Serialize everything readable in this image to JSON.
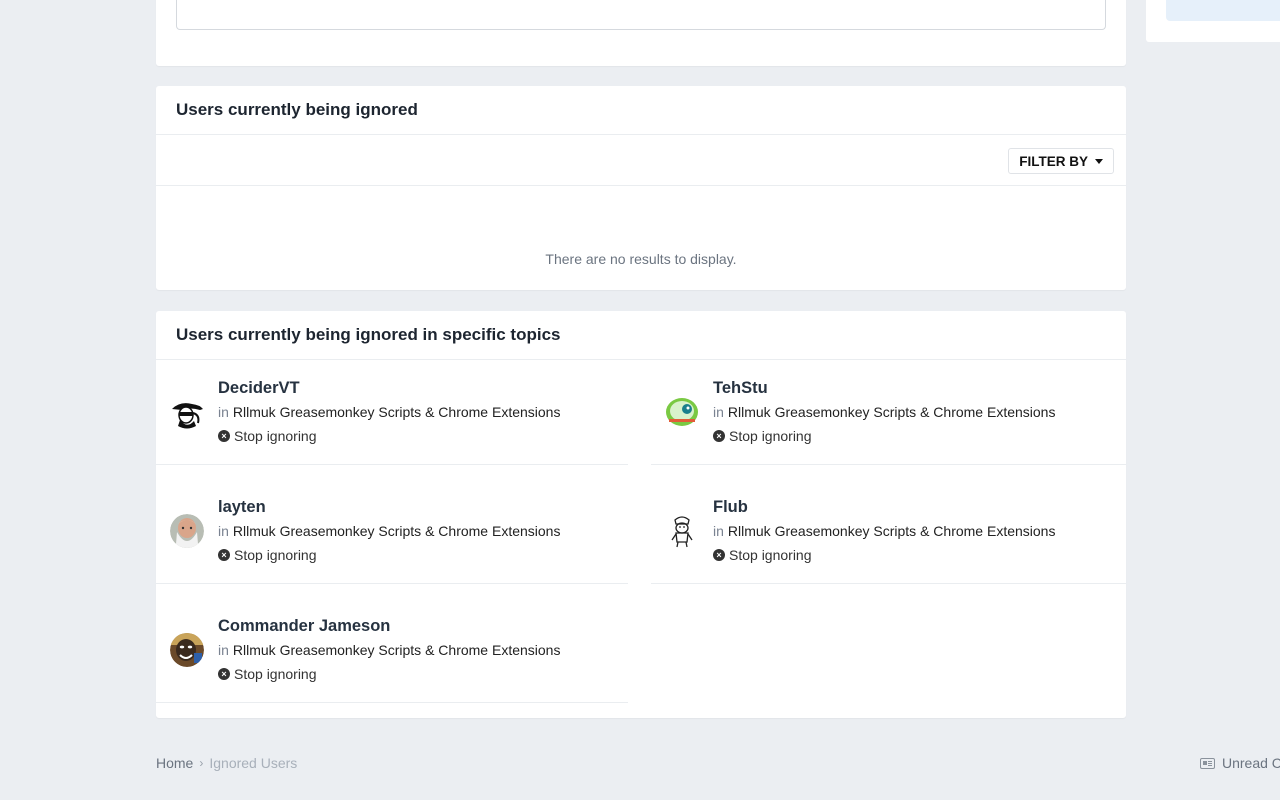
{
  "panel1": {
    "title": "Users currently being ignored",
    "filter_label": "FILTER BY",
    "empty_message": "There are no results to display."
  },
  "panel2": {
    "title": "Users currently being ignored in specific topics",
    "in_label": "in",
    "stop_label": "Stop ignoring",
    "users": [
      {
        "name": "DeciderVT",
        "forum": "Rllmuk Greasemonkey Scripts & Chrome Extensions"
      },
      {
        "name": "TehStu",
        "forum": "Rllmuk Greasemonkey Scripts & Chrome Extensions"
      },
      {
        "name": "layten",
        "forum": "Rllmuk Greasemonkey Scripts & Chrome Extensions"
      },
      {
        "name": "Flub",
        "forum": "Rllmuk Greasemonkey Scripts & Chrome Extensions"
      },
      {
        "name": "Commander Jameson",
        "forum": "Rllmuk Greasemonkey Scripts & Chrome Extensions"
      }
    ]
  },
  "breadcrumb": {
    "home": "Home",
    "current": "Ignored Users"
  },
  "footer": {
    "unread_label": "Unread C"
  },
  "colors": {
    "page_bg": "#ebeef2",
    "panel_bg": "#ffffff",
    "title_text": "#1d2530",
    "muted_text": "#6b7480"
  }
}
